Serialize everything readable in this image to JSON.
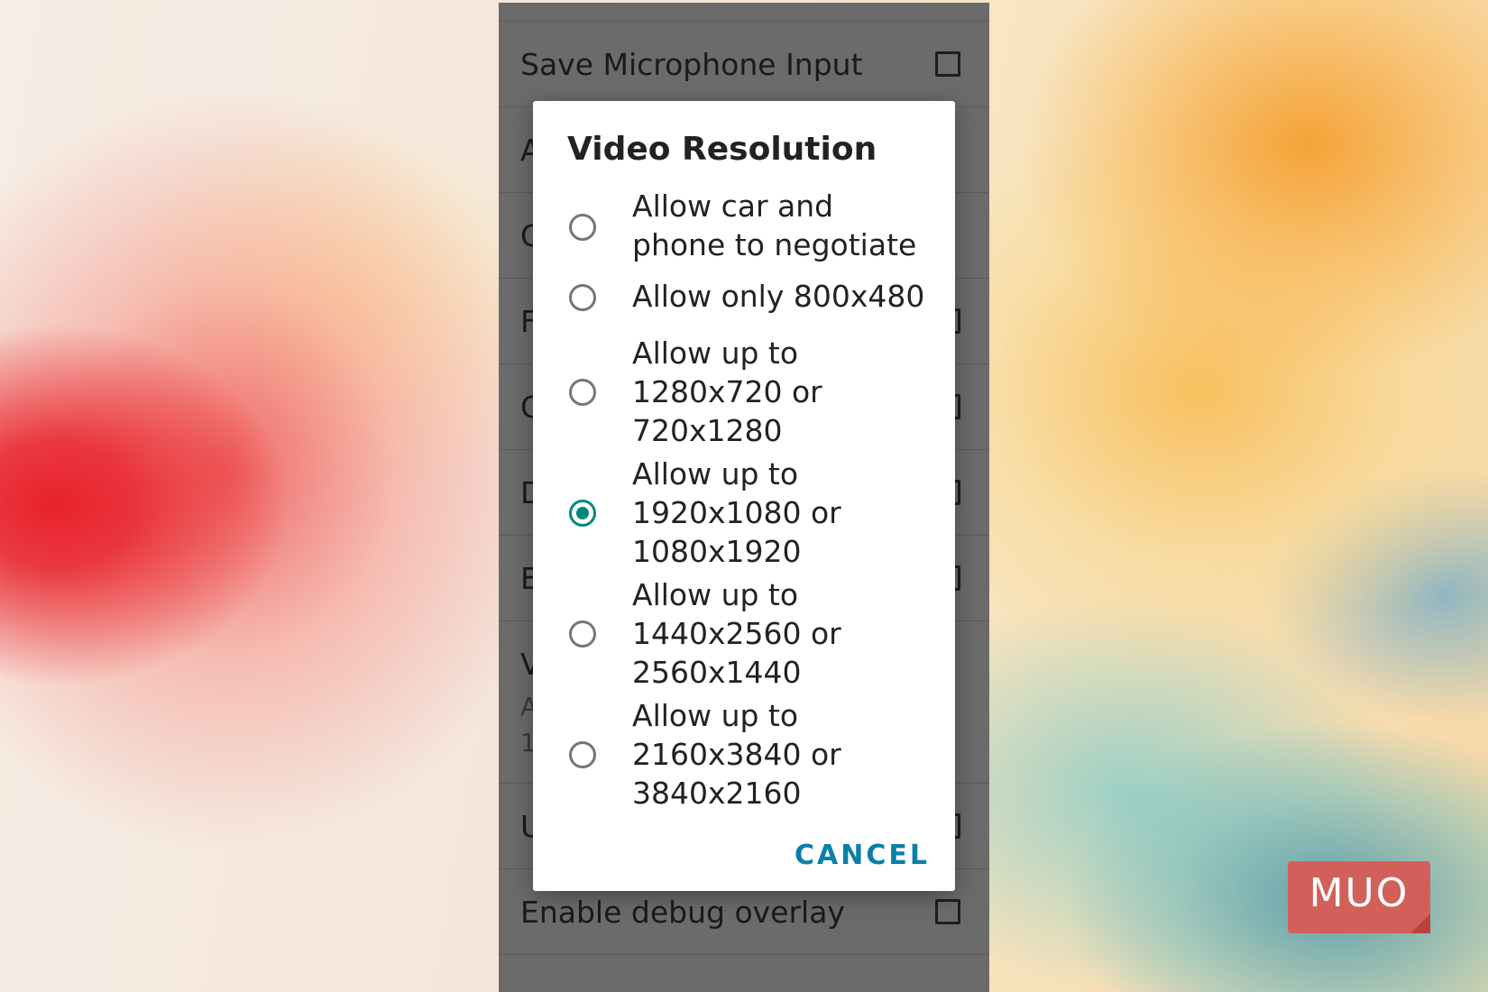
{
  "settings": {
    "rows": [
      {
        "label": "Save Microphone Input"
      },
      {
        "label": "A"
      },
      {
        "label": "C"
      },
      {
        "label": "F"
      },
      {
        "label": "C"
      },
      {
        "label": "D"
      },
      {
        "label": "E"
      },
      {
        "label": "V",
        "sub1": "A",
        "sub2": "1"
      },
      {
        "label": "U"
      },
      {
        "label": "Enable debug overlay"
      }
    ]
  },
  "dialog": {
    "title": "Video Resolution",
    "options": [
      {
        "label": "Allow car and phone to negotiate",
        "selected": false
      },
      {
        "label": "Allow only 800x480",
        "selected": false
      },
      {
        "label": "Allow up to 1280x720 or 720x1280",
        "selected": false
      },
      {
        "label": "Allow up to 1920x1080 or 1080x1920",
        "selected": true
      },
      {
        "label": "Allow up to 1440x2560 or 2560x1440",
        "selected": false
      },
      {
        "label": "Allow up to 2160x3840 or 3840x2160",
        "selected": false
      }
    ],
    "cancel_label": "CANCEL",
    "accent_color": "#00897b",
    "button_color": "#0a7fa8"
  },
  "watermark": {
    "text": "MUO"
  }
}
